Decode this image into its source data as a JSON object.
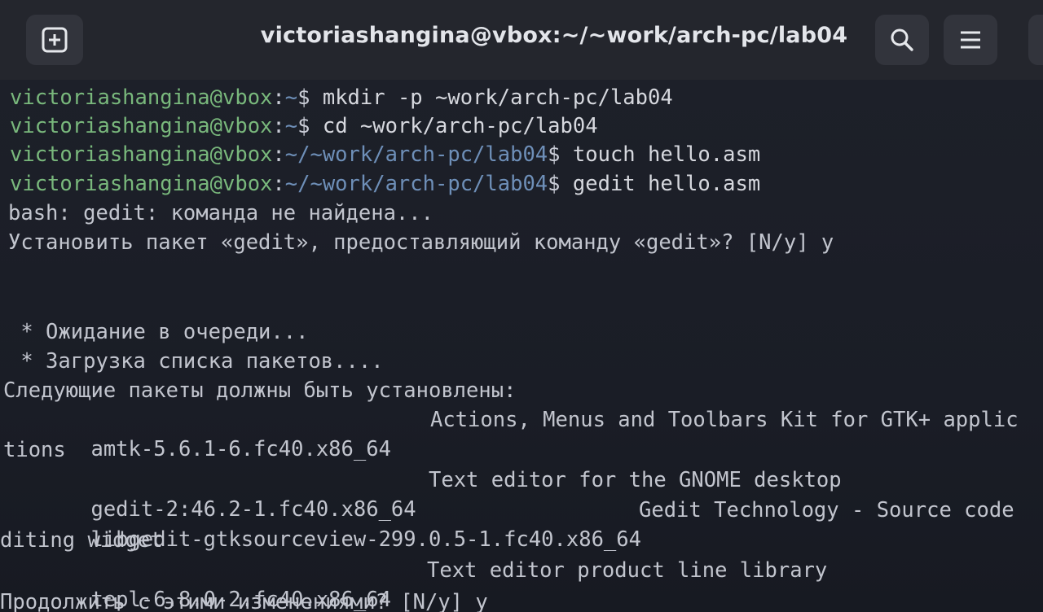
{
  "window": {
    "title": "victoriashangina@vbox:~/~work/arch-pc/lab04"
  },
  "icons": {
    "new_tab": "new-tab-plus-icon",
    "search": "search-icon",
    "menu": "hamburger-menu-icon"
  },
  "terminal": {
    "commands": [
      {
        "user": "victoriashangina@vbox",
        "path": "~",
        "symbol": "$ ",
        "command": "mkdir -p ~work/arch-pc/lab04"
      },
      {
        "user": "victoriashangina@vbox",
        "path": "~",
        "symbol": "$ ",
        "command": "cd ~work/arch-pc/lab04"
      },
      {
        "user": "victoriashangina@vbox",
        "path": "~/~work/arch-pc/lab04",
        "symbol": "$ ",
        "command": "touch hello.asm"
      },
      {
        "user": "victoriashangina@vbox",
        "path": "~/~work/arch-pc/lab04",
        "symbol": "$ ",
        "command": "gedit hello.asm"
      }
    ],
    "not_found": "bash: gedit: команда не найдена...",
    "install_prompt": "Установить пакет «gedit», предоставляющий команду «gedit»? [N/y] y",
    "waiting": " * Ожидание в очереди...",
    "loading": " * Загрузка списка пакетов....",
    "packages_header": "Следующие пакеты должны быть установлены:",
    "packages": [
      {
        "name": " amtk-5.6.1-6.fc40.x86_64",
        "desc": "Actions, Menus and Toolbars Kit for GTK+ applic",
        "wrap": "tions"
      },
      {
        "name": " gedit-2:46.2-1.fc40.x86_64",
        "desc": "Text editor for the GNOME desktop",
        "wrap": ""
      },
      {
        "name": " libgedit-gtksourceview-299.0.5-1.fc40.x86_64",
        "desc": "Gedit Technology - Source code",
        "wrap": "diting widget"
      },
      {
        "name": " tepl-6.8.0-2.fc40.x86_64",
        "desc": "Text editor product line library",
        "wrap": ""
      }
    ],
    "continue_prompt": "Продолжить с этими изменениями? [N/y] y"
  }
}
